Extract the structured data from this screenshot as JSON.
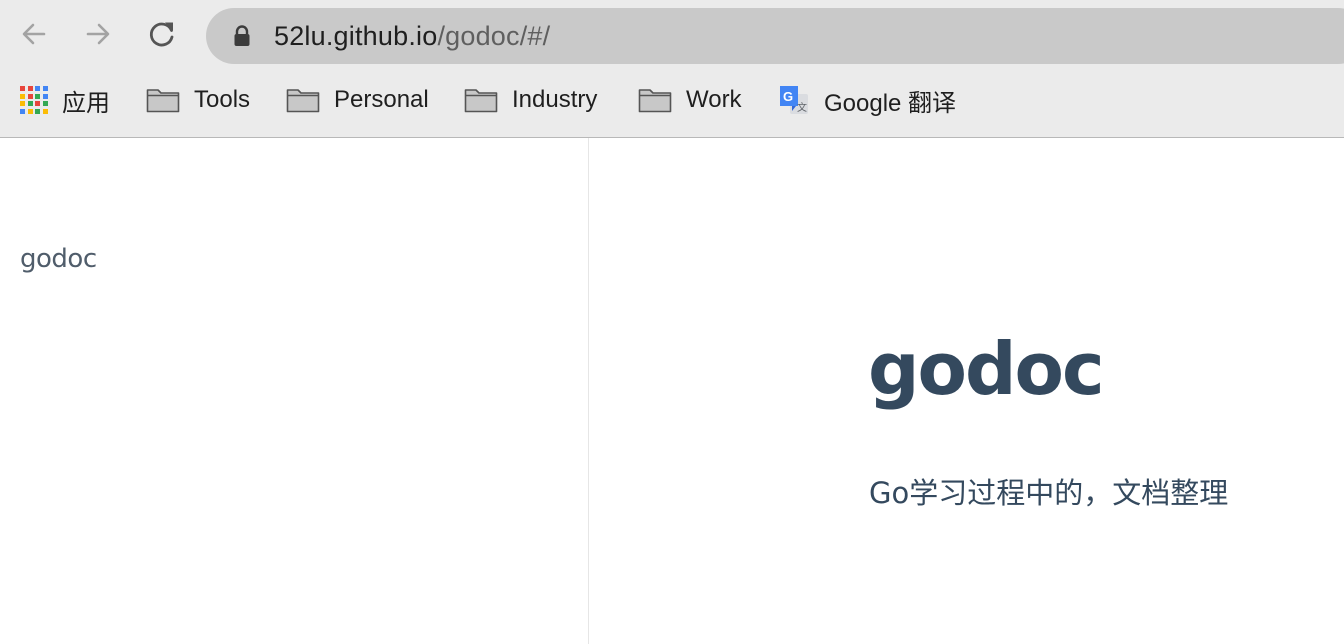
{
  "browser": {
    "nav": {
      "back_icon": "arrow-left-icon",
      "forward_icon": "arrow-right-icon",
      "reload_icon": "reload-icon"
    },
    "address_bar": {
      "lock_icon": "lock-icon",
      "host": "52lu.github.io",
      "path": "/godoc/#/"
    },
    "bookmarks": [
      {
        "label": "应用",
        "icon": "apps-grid-icon"
      },
      {
        "label": "Tools",
        "icon": "folder-icon"
      },
      {
        "label": "Personal",
        "icon": "folder-icon"
      },
      {
        "label": "Industry",
        "icon": "folder-icon"
      },
      {
        "label": "Work",
        "icon": "folder-icon"
      },
      {
        "label": "Google 翻译",
        "icon": "google-translate-icon"
      }
    ]
  },
  "sidebar": {
    "title": "godoc"
  },
  "cover": {
    "title": "godoc",
    "subtitle": "Go学习过程中的，文档整理"
  },
  "colors": {
    "chrome_bg": "#ebebeb",
    "omnibox_bg": "#c9c9c9",
    "heading": "#34495e",
    "sidebar_text": "#505d6b"
  }
}
